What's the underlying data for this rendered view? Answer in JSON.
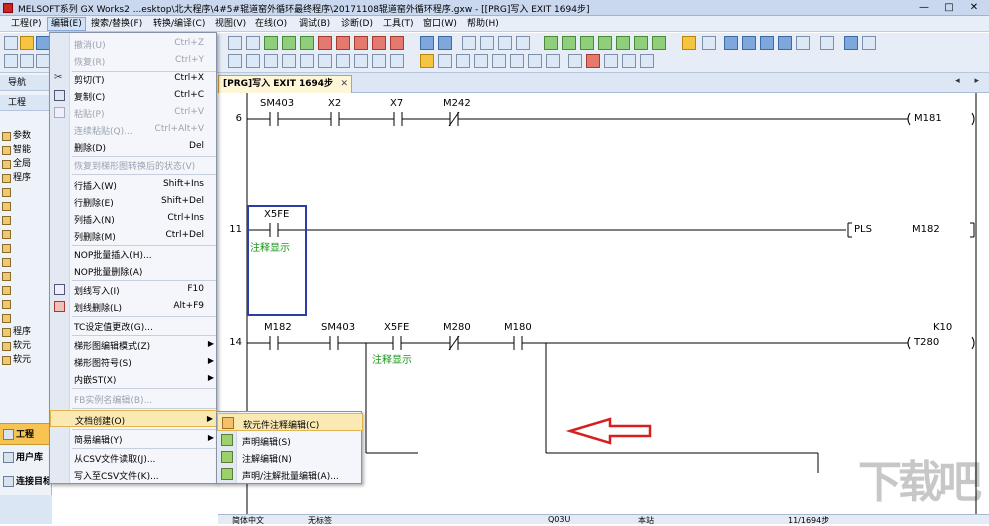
{
  "titlebar": {
    "title": "MELSOFT系列 GX Works2 ...esktop\\北大程序\\4#5#辊道窑外循环最终程序\\20171108辊道窑外循环程序.gxw - [[PRG]写入 EXIT 1694步]",
    "minimize": "—",
    "maximize": "□",
    "close": "✕"
  },
  "menubar": {
    "items": [
      "工程(P)",
      "编辑(E)",
      "搜索/替换(F)",
      "转换/编译(C)",
      "视图(V)",
      "在线(O)",
      "调试(B)",
      "诊断(D)",
      "工具(T)",
      "窗口(W)",
      "帮助(H)"
    ]
  },
  "left_panel": {
    "nav_label": "导航",
    "project_label": "工程",
    "tree": [
      "参数",
      "智能",
      "全局",
      "程序",
      "",
      "",
      "",
      "",
      "",
      "",
      "",
      "",
      "",
      "",
      "程序",
      "软元",
      "软元"
    ],
    "nav_buttons": [
      "工程",
      "用户库",
      "连接目标"
    ],
    "expand": "»"
  },
  "edit_menu": {
    "items": [
      {
        "label": "撤消(U)",
        "shortcut": "Ctrl+Z",
        "disabled": true
      },
      {
        "label": "恢复(R)",
        "shortcut": "Ctrl+Y",
        "disabled": true
      },
      {
        "label": "剪切(T)",
        "shortcut": "Ctrl+X",
        "disabled": false
      },
      {
        "label": "复制(C)",
        "shortcut": "Ctrl+C",
        "disabled": false
      },
      {
        "label": "粘贴(P)",
        "shortcut": "Ctrl+V",
        "disabled": true
      },
      {
        "label": "连续粘贴(Q)...",
        "shortcut": "Ctrl+Alt+V",
        "disabled": true
      },
      {
        "label": "删除(D)",
        "shortcut": "Del",
        "disabled": false
      },
      {
        "label": "恢复到梯形图转换后的状态(V)",
        "shortcut": "",
        "disabled": true
      },
      {
        "label": "行插入(W)",
        "shortcut": "Shift+Ins",
        "disabled": false
      },
      {
        "label": "行删除(E)",
        "shortcut": "Shift+Del",
        "disabled": false
      },
      {
        "label": "列插入(N)",
        "shortcut": "Ctrl+Ins",
        "disabled": false
      },
      {
        "label": "列删除(M)",
        "shortcut": "Ctrl+Del",
        "disabled": false
      },
      {
        "label": "NOP批量插入(H)...",
        "shortcut": "",
        "disabled": false
      },
      {
        "label": "NOP批量删除(A)",
        "shortcut": "",
        "disabled": false
      },
      {
        "label": "划线写入(I)",
        "shortcut": "F10",
        "disabled": false
      },
      {
        "label": "划线删除(L)",
        "shortcut": "Alt+F9",
        "disabled": false
      },
      {
        "label": "TC设定值更改(G)...",
        "shortcut": "",
        "disabled": false
      },
      {
        "label": "梯形图编辑模式(Z)",
        "shortcut": "",
        "disabled": false,
        "submenu": true
      },
      {
        "label": "梯形图符号(S)",
        "shortcut": "",
        "disabled": false,
        "submenu": true
      },
      {
        "label": "内嵌ST(X)",
        "shortcut": "",
        "disabled": false,
        "submenu": true
      },
      {
        "label": "FB实例名编辑(B)...",
        "shortcut": "",
        "disabled": true
      },
      {
        "label": "文档创建(O)",
        "shortcut": "",
        "disabled": false,
        "submenu": true,
        "highlighted": true
      },
      {
        "label": "简易编辑(Y)",
        "shortcut": "",
        "disabled": false,
        "submenu": true
      },
      {
        "label": "从CSV文件读取(J)...",
        "shortcut": "",
        "disabled": false
      },
      {
        "label": "写入至CSV文件(K)...",
        "shortcut": "",
        "disabled": false
      }
    ]
  },
  "doc_submenu": {
    "items": [
      "软元件注释编辑(C)",
      "声明编辑(S)",
      "注解编辑(N)",
      "声明/注解批量编辑(A)..."
    ]
  },
  "editor": {
    "tab_label": "[PRG]写入 EXIT 1694步",
    "tab_close": "✕",
    "nav_arrows": "◂ ▸",
    "rungs": [
      {
        "step": "6",
        "contacts": [
          "SM403",
          "X2",
          "X7",
          "M242"
        ],
        "coil": "M181"
      },
      {
        "step": "11",
        "contacts": [
          "X5FE"
        ],
        "comment": "注释显示",
        "instruction": "PLS",
        "operand": "M182"
      },
      {
        "step": "14",
        "contacts": [
          "M182",
          "SM403",
          "X5FE",
          "M280",
          "M180"
        ],
        "comment": "注释显示",
        "coil": "T280",
        "setpoint": "K10"
      }
    ]
  },
  "watermark": "下载吧",
  "statusbar": [
    "简体中文",
    "无标签",
    "Q03U",
    "本站",
    "11/1694步"
  ],
  "colors": {
    "highlight": "#fbe9b4",
    "comment_green": "#1a9a1a",
    "cursor_blue": "#2a3da8",
    "arrow_red": "#d62020"
  }
}
